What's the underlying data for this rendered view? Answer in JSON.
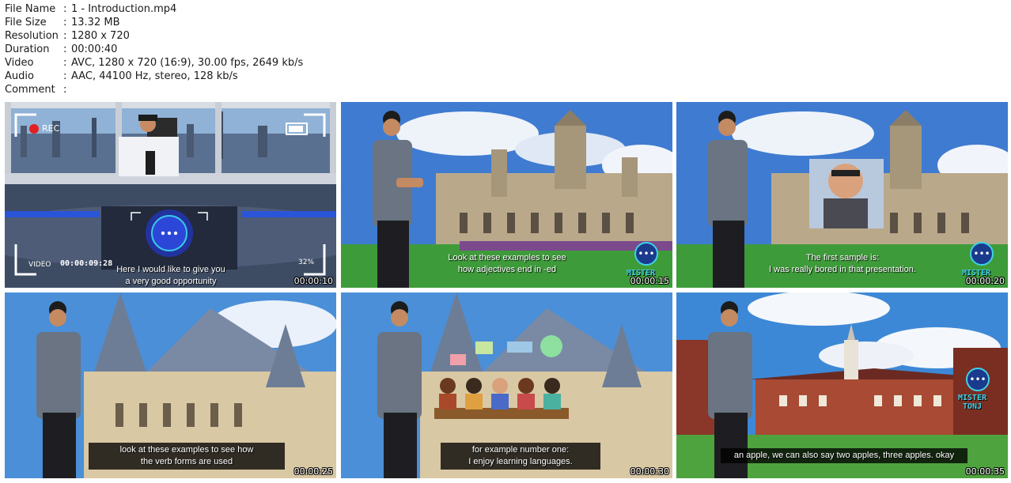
{
  "info": {
    "rows": [
      {
        "label": "File Name",
        "value": "1 - Introduction.mp4"
      },
      {
        "label": "File Size",
        "value": "13.32 MB"
      },
      {
        "label": "Resolution",
        "value": "1280 x 720"
      },
      {
        "label": "Duration",
        "value": "00:00:40"
      },
      {
        "label": "Video",
        "value": "AVC, 1280 x 720 (16:9), 30.00 fps, 2649 kb/s"
      },
      {
        "label": "Audio",
        "value": "AAC, 44100 Hz, stereo, 128 kb/s"
      },
      {
        "label": "Comment",
        "value": ""
      }
    ],
    "separator": ":"
  },
  "thumbnails": [
    {
      "timestamp": "00:00:10",
      "subtitle": [
        "Here I would like to give you",
        "a very good opportunity"
      ],
      "overlay": {
        "rec": "REC",
        "video": "VIDEO",
        "timecode": "00:00:09:28",
        "battery": "32%"
      },
      "icon": "chat-bubble-icon"
    },
    {
      "timestamp": "00:00:15",
      "subtitle": [
        "Look at these examples to see",
        "how adjectives end in -ed"
      ],
      "brand": "MISTER",
      "icon": "chat-bubble-icon"
    },
    {
      "timestamp": "00:00:20",
      "subtitle": [
        "The first sample is:",
        "I was really bored in that presentation."
      ],
      "brand": "MISTER",
      "icon": "chat-bubble-icon"
    },
    {
      "timestamp": "00:00:25",
      "subtitle": [
        "look at these examples to see how",
        "the verb forms are used"
      ]
    },
    {
      "timestamp": "00:00:30",
      "subtitle": [
        "for example number one:",
        "I enjoy learning languages."
      ]
    },
    {
      "timestamp": "00:00:35",
      "subtitle": [
        "an apple, we can also say two apples, three apples. okay"
      ],
      "brand": [
        "MISTER",
        "TONJ"
      ],
      "icon": "chat-bubble-icon"
    }
  ],
  "colors": {
    "badge_bg": "#1a3a8c",
    "badge_border": "#3fd0e8",
    "rec_dot": "#e32020"
  }
}
